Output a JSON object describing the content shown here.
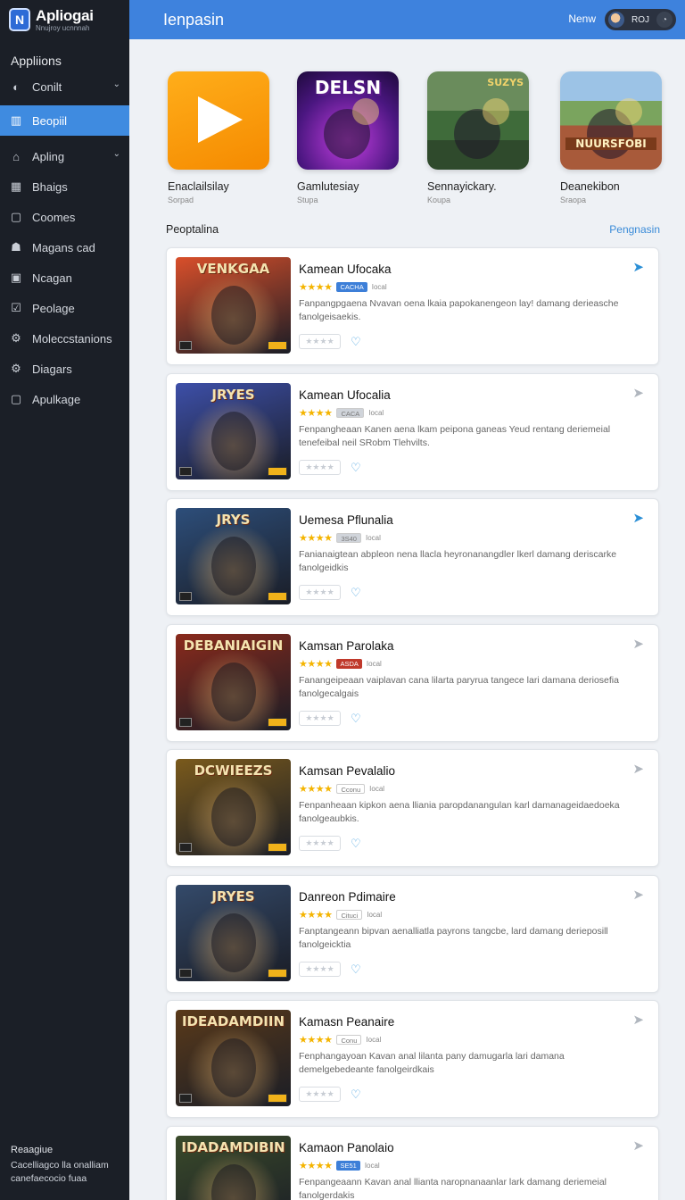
{
  "brand": {
    "name": "Apliogai",
    "subtitle": "Nnujroy  ucnnnah",
    "logo_glyph": "N"
  },
  "sidebar": {
    "section_label": "Appliions",
    "items": [
      {
        "label": "Conilt",
        "icon": "gauge-icon",
        "glyph": "◐",
        "has_chevron": true,
        "active": false
      },
      {
        "label": "Beopiil",
        "icon": "chart-icon",
        "glyph": "▥",
        "has_chevron": false,
        "active": true
      },
      {
        "label": "Apling",
        "icon": "home-icon",
        "glyph": "⌂",
        "has_chevron": true,
        "active": false
      },
      {
        "label": "Bhaigs",
        "icon": "grid-icon",
        "glyph": "▦",
        "has_chevron": false,
        "active": false
      },
      {
        "label": "Coomes",
        "icon": "square-icon",
        "glyph": "▢",
        "has_chevron": false,
        "active": false
      },
      {
        "label": "Magans cad",
        "icon": "user-icon",
        "glyph": "☗",
        "has_chevron": false,
        "active": false
      },
      {
        "label": "Ncagan",
        "icon": "box-icon",
        "glyph": "▣",
        "has_chevron": false,
        "active": false
      },
      {
        "label": "Peolage",
        "icon": "checkbox-icon",
        "glyph": "☑",
        "has_chevron": false,
        "active": false
      },
      {
        "label": "Moleccstanions",
        "icon": "gear-icon",
        "glyph": "⚙",
        "has_chevron": false,
        "active": false
      },
      {
        "label": "Diagars",
        "icon": "gear-icon",
        "glyph": "⚙",
        "has_chevron": false,
        "active": false
      },
      {
        "label": "Apulkage",
        "icon": "square-icon",
        "glyph": "▢",
        "has_chevron": false,
        "active": false
      }
    ],
    "chevron_glyph": "⌄",
    "footer": {
      "title": "Reaagiue",
      "line1": "Cacelliagco lla onalliam",
      "line2": "canefaecocio fuaa"
    }
  },
  "header": {
    "title": "Ienpasin",
    "new_label": "Nenw",
    "user_name": "ROJ",
    "toggle_glyph": "◔"
  },
  "featured": [
    {
      "title": "Enaclailsilay",
      "subtitle": "Sorpad",
      "art": "play",
      "art_label": ""
    },
    {
      "title": "Gamlutesiay",
      "subtitle": "Stupa",
      "art": "purple",
      "art_label": "DELSN"
    },
    {
      "title": "Sennayickary.",
      "subtitle": "Koupa",
      "art": "green",
      "art_label": "SUZYS"
    },
    {
      "title": "Deanekibon",
      "subtitle": "Sraopa",
      "art": "war",
      "art_label": "NUURSFOBI"
    }
  ],
  "list_section": {
    "title": "Peoptalina",
    "link": "Pengnasin"
  },
  "icons": {
    "star_glyphs": "★★★★",
    "rate_glyphs": "★★★★",
    "heart_glyph": "♡",
    "arrow_glyph": "➤"
  },
  "games": [
    {
      "title": "Kamean Ufocaka",
      "badge": "CACHA",
      "badge_color": "#3d7fd8",
      "tag": "Iocal",
      "desc": "Fanpangpgaena Nvavan oena lkaia papokanengeon lay! damang derieasche fanolgeisaekis.",
      "thumb_title": "VENKGAA",
      "thumb_color": "#d94f2a",
      "arrow_active": true
    },
    {
      "title": "Kamean Ufocalia",
      "badge": "CACA",
      "badge_color": "#d0d4da",
      "tag": "Iocal",
      "desc": "Fenpangheaan Kanen aena lkam peipona ganeas Yeud rentang deriemeial tenefeibal neil SRobm Tlehvilts.",
      "thumb_title": "JRYES",
      "thumb_color": "#3d4fa8",
      "arrow_active": false
    },
    {
      "title": "Uemesa Pflunalia",
      "badge": "3S40",
      "badge_color": "#d0d4da",
      "tag": "Iocal",
      "desc": "Fanianaigtean abpleon nena llacla heyronanangdler lkerl damang deriscarke fanolgeidkis",
      "thumb_title": "JRYS",
      "thumb_color": "#2d4e7a",
      "arrow_active": true
    },
    {
      "title": "Kamsan Parolaka",
      "badge": "ASDA",
      "badge_color": "#c0392b",
      "tag": "Iocal",
      "desc": "Fanangeipeaan vaiplavan cana lilarta paryrua tangece lari damana deriosefia fanolgecalgais",
      "thumb_title": "DEBANIAIGIN",
      "thumb_color": "#8a2a1c",
      "arrow_active": false
    },
    {
      "title": "Kamsan Pevalalio",
      "badge": "Cconu",
      "badge_color": "#ffffff",
      "tag": "Iocal",
      "desc": "Fenpanheaan kipkon aena lliania paropdanangulan karl damanageidaedoeka fanolgeaubkis.",
      "thumb_title": "DCWIEEZS",
      "thumb_color": "#7a5a1c",
      "arrow_active": false
    },
    {
      "title": "Danreon Pdimaire",
      "badge": "Cituci",
      "badge_color": "#ffffff",
      "tag": "Iocal",
      "desc": "Fanptangeann bipvan aenalliatla payrons tangcbe, lard damang derieposill fanolgeicktia",
      "thumb_title": "JRYES",
      "thumb_color": "#344a6a",
      "arrow_active": false
    },
    {
      "title": "Kamasn Peanaire",
      "badge": "Conu",
      "badge_color": "#ffffff",
      "tag": "Iocal",
      "desc": "Fenphangayoan Kavan anal lilanta pany damugarla lari damana demelgebedeante fanolgeirdkais",
      "thumb_title": "IDEADAMDIIN",
      "thumb_color": "#5a3a1a",
      "arrow_active": false
    },
    {
      "title": "Kamaon Panolaio",
      "badge": "SE51",
      "badge_color": "#3d7fd8",
      "tag": "Iocal",
      "desc": "Fenpangeaann Kavan anal llianta naropnanaanlar lark damang deriemeial fanolgerdakis",
      "thumb_title": "IDADAMDIBIN",
      "thumb_color": "#3a4a2a",
      "arrow_active": false
    }
  ]
}
